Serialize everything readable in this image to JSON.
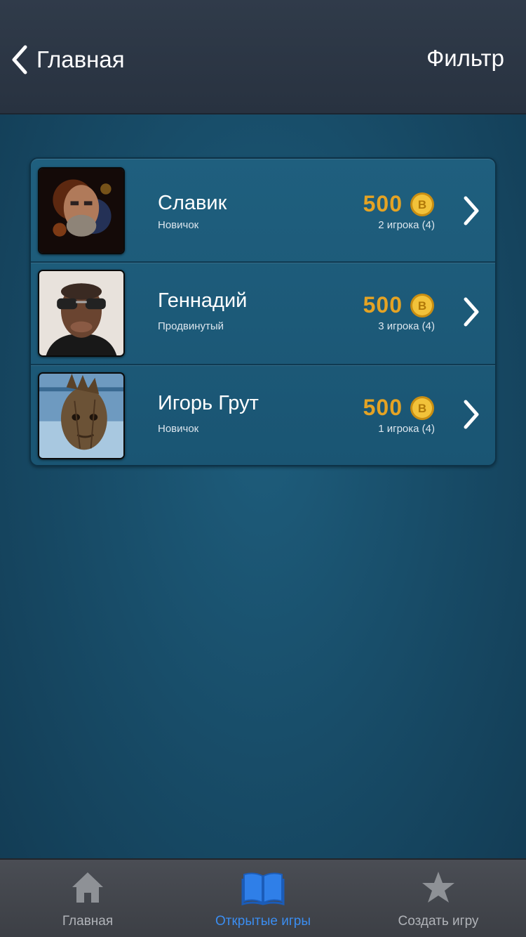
{
  "header": {
    "back_label": "Главная",
    "filter_label": "Фильтр"
  },
  "games": [
    {
      "name": "Славик",
      "level": "Новичок",
      "bet": "500",
      "players": "2 игрока (4)",
      "avatar": "portrait-avatar"
    },
    {
      "name": "Геннадий",
      "level": "Продвинутый",
      "bet": "500",
      "players": "3 игрока (4)",
      "avatar": "sunglasses-caricature-avatar"
    },
    {
      "name": "Игорь Грут",
      "level": "Новичок",
      "bet": "500",
      "players": "1 игрока (4)",
      "avatar": "groot-avatar"
    }
  ],
  "tabbar": {
    "tabs": [
      {
        "label": "Главная",
        "icon": "home-icon",
        "active": false
      },
      {
        "label": "Открытые игры",
        "icon": "open-book-icon",
        "active": true
      },
      {
        "label": "Создать игру",
        "icon": "star-icon",
        "active": false
      }
    ]
  },
  "colors": {
    "accent": "#3b8df0",
    "bet_gold": "#e4a324",
    "background": "#1a5573",
    "header": "#2c3644"
  }
}
